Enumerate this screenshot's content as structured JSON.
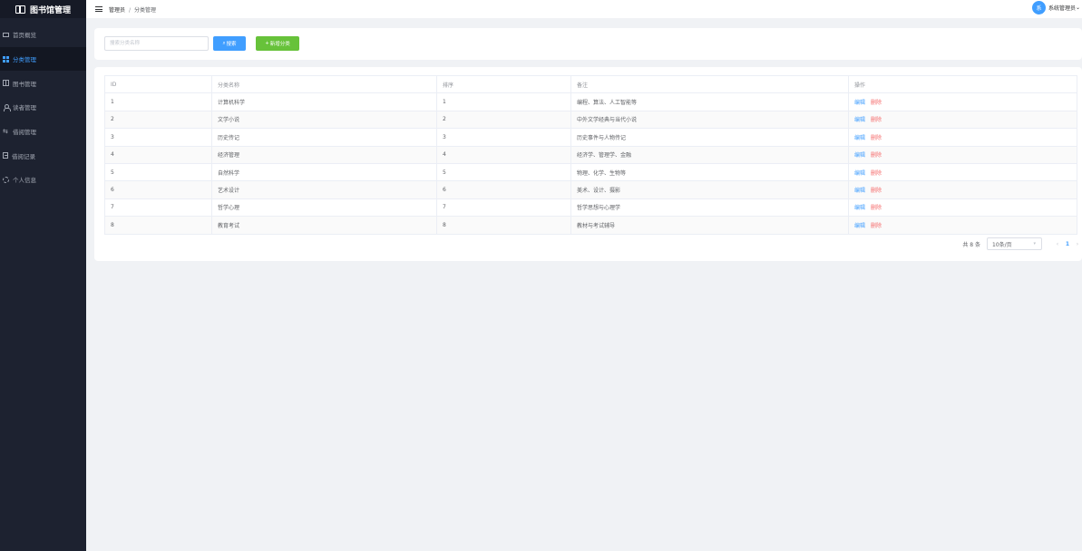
{
  "sidebar": {
    "logo_text": "图书馆管理",
    "items": [
      {
        "label": "首页概览",
        "icon": "monitor-icon"
      },
      {
        "label": "分类管理",
        "icon": "grid-icon",
        "active": true
      },
      {
        "label": "图书管理",
        "icon": "book-icon"
      },
      {
        "label": "读者管理",
        "icon": "user-icon"
      },
      {
        "label": "借阅管理",
        "icon": "swap-icon"
      },
      {
        "label": "借阅记录",
        "icon": "document-icon"
      },
      {
        "label": "个人信息",
        "icon": "gear-icon"
      }
    ]
  },
  "header": {
    "breadcrumb": [
      "管理员",
      "分类管理"
    ],
    "breadcrumb_sep": "/",
    "avatar_text": "系",
    "username": "系统管理员"
  },
  "search": {
    "placeholder": "搜索分类名称",
    "value": "",
    "search_label": "搜索",
    "add_label": "新增分类"
  },
  "table": {
    "columns": [
      "ID",
      "分类名称",
      "排序",
      "备注",
      "操作"
    ],
    "rows": [
      {
        "id": "1",
        "name": "计算机科学",
        "sort": "1",
        "remark": "编程、算法、人工智能等"
      },
      {
        "id": "2",
        "name": "文学小说",
        "sort": "2",
        "remark": "中外文学经典与当代小说"
      },
      {
        "id": "3",
        "name": "历史传记",
        "sort": "3",
        "remark": "历史事件与人物传记"
      },
      {
        "id": "4",
        "name": "经济管理",
        "sort": "4",
        "remark": "经济学、管理学、金融"
      },
      {
        "id": "5",
        "name": "自然科学",
        "sort": "5",
        "remark": "物理、化学、生物等"
      },
      {
        "id": "6",
        "name": "艺术设计",
        "sort": "6",
        "remark": "美术、设计、摄影"
      },
      {
        "id": "7",
        "name": "哲学心理",
        "sort": "7",
        "remark": "哲学思想与心理学"
      },
      {
        "id": "8",
        "name": "教育考试",
        "sort": "8",
        "remark": "教材与考试辅导"
      }
    ],
    "edit_label": "编辑",
    "delete_label": "删除"
  },
  "pagination": {
    "total_text": "共 8 条",
    "page_size": "10条/页",
    "current_page": "1"
  },
  "colors": {
    "primary": "#409eff",
    "success": "#67c23a",
    "danger": "#f56c6c",
    "sidebar_bg": "#1d2230"
  }
}
